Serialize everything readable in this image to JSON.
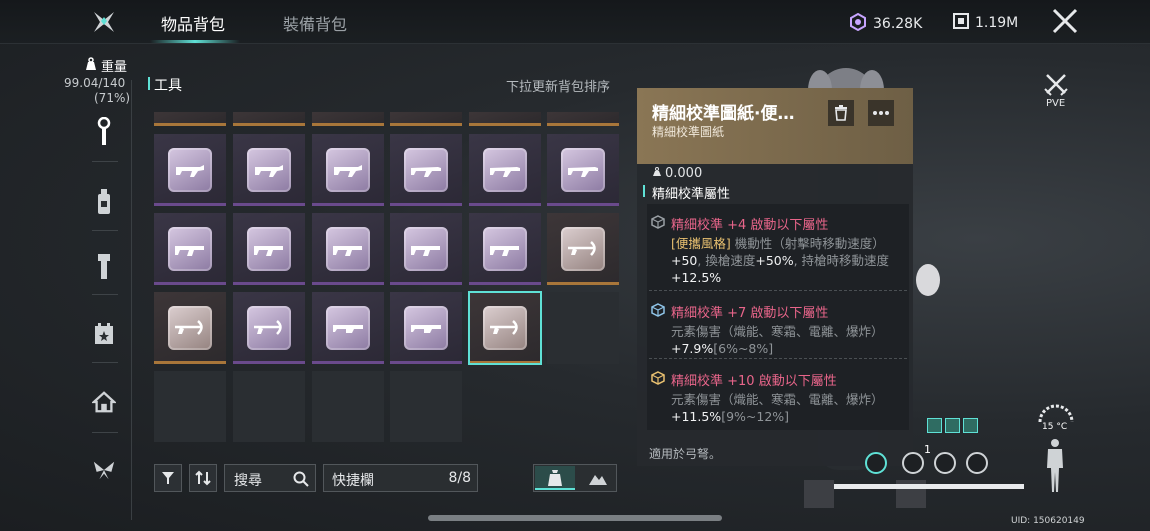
{
  "header": {
    "tabs": [
      {
        "label": "物品背包",
        "active": true
      },
      {
        "label": "裝備背包",
        "active": false
      }
    ],
    "currencies": [
      {
        "icon": "crystal-icon",
        "value": "36.28K"
      },
      {
        "icon": "token-icon",
        "value": "1.19M"
      }
    ]
  },
  "sidebar": {
    "weight_label": "重量",
    "weight_value": "99.04/140",
    "weight_percent": "(71%)",
    "categories": [
      {
        "icon": "wrench-icon",
        "active": true
      },
      {
        "icon": "bottle-icon",
        "active": false
      },
      {
        "icon": "flashlight-icon",
        "active": false
      },
      {
        "icon": "calendar-star-icon",
        "active": false
      },
      {
        "icon": "house-icon",
        "active": false
      },
      {
        "icon": "butterfly-icon",
        "active": false
      }
    ]
  },
  "inventory": {
    "section_title": "工具",
    "sort_hint": "下拉更新背包排序",
    "search_label": "搜尋",
    "quickbar_label": "快捷欄",
    "quickbar_count": "8/8",
    "rows": [
      [
        "purple",
        "purple",
        "purple",
        "purple",
        "purple",
        "purple"
      ],
      [
        "purple",
        "purple",
        "purple",
        "purple",
        "purple",
        "gold"
      ],
      [
        "gold",
        "purple",
        "purple",
        "purple",
        "gold-selected",
        "empty"
      ],
      [
        "empty",
        "empty",
        "empty",
        "empty"
      ]
    ]
  },
  "tooltip": {
    "title": "精細校準圖紙·便…",
    "subtitle": "精細校準圖紙",
    "weight": "0.000",
    "attr_heading": "精細校準屬性",
    "blocks": [
      {
        "title": "精細校準 +4 啟動以下屬性",
        "tag": "[便攜風格]",
        "t1": " 機動性（射擊時移動速度）",
        "v1": "+50",
        "t2": ", 換槍速度",
        "v2": "+50%",
        "t3": ", 持槍時移動速度",
        "v3": "+12.5%"
      },
      {
        "title": "精細校準 +7 啟動以下屬性",
        "text": "元素傷害（熾能、寒霜、電離、爆炸）",
        "value": "+7.9%",
        "range": "[6%~8%]"
      },
      {
        "title": "精細校準 +10 啟動以下屬性",
        "text": "元素傷害（熾能、寒霜、電離、爆炸）",
        "value": "+11.5%",
        "range": "[9%~12%]"
      }
    ],
    "footer": "適用於弓弩。"
  },
  "hud": {
    "mode": "PVE",
    "temperature": "15 °C",
    "counter": "1",
    "uid": "UID: 150620149"
  },
  "colors": {
    "accent": "#5fe1d6",
    "purple_rarity": "#6a4a8c",
    "gold_rarity": "#a8763a",
    "tooltip_header": "#8a7655",
    "attr_pink": "#e8658a"
  }
}
